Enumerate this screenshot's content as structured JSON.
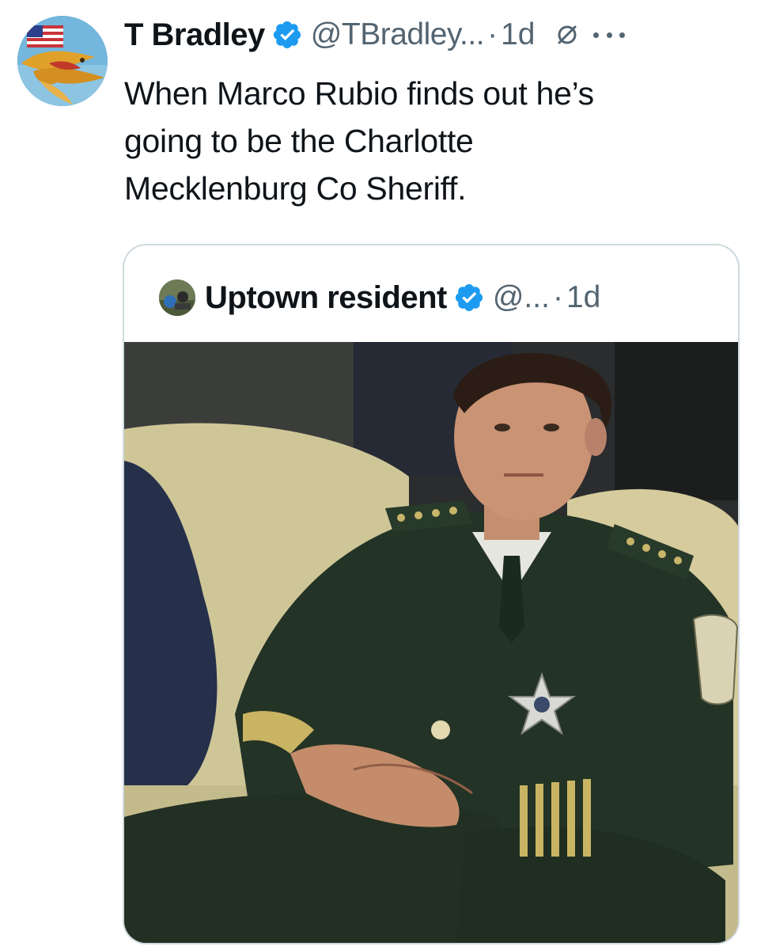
{
  "tweet": {
    "display_name": "T Bradley",
    "handle": "@TBradley...",
    "separator": "·",
    "time": "1d",
    "text_lines": [
      "When Marco Rubio finds out he’s",
      "going to be the Charlotte",
      "Mecklenburg Co Sheriff."
    ],
    "icons": {
      "verified": "verified-badge-icon",
      "null": "null-circle-icon",
      "more": "more-options-icon"
    }
  },
  "quote": {
    "display_name": "Uptown resident",
    "handle": "@...",
    "separator": "·",
    "time": "1d",
    "icons": {
      "verified": "verified-badge-icon"
    }
  },
  "colors": {
    "verified_blue": "#1d9bf0",
    "text_primary": "#0f1419",
    "text_secondary": "#536471",
    "border": "#cfd9de"
  }
}
